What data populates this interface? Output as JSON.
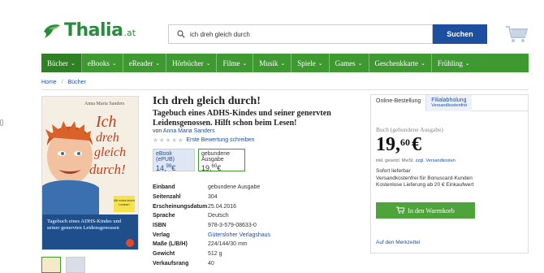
{
  "header": {
    "logo_text": "Thalia",
    "logo_tld": ".at",
    "search_value": "ich dreh gleich durch",
    "search_button": "Suchen",
    "brand_color": "#2a8a3e"
  },
  "nav": {
    "items": [
      {
        "label": "Bücher"
      },
      {
        "label": "eBooks"
      },
      {
        "label": "eReader"
      },
      {
        "label": "Hörbücher"
      },
      {
        "label": "Filme"
      },
      {
        "label": "Musik"
      },
      {
        "label": "Spiele"
      },
      {
        "label": "Games"
      },
      {
        "label": "Geschenkkarte"
      },
      {
        "label": "Frühling"
      }
    ],
    "chevron": "⌄"
  },
  "breadcrumb": {
    "home": "Home",
    "category": "Bücher",
    "sep": "/"
  },
  "cover": {
    "author": "Anna Maria Sanders",
    "title_line1": "Ich",
    "title_line2": "dreh",
    "title_line3": "gleich",
    "title_line4": "durch!",
    "sticker": "Mit extra leicht Lesbar!",
    "subtitle": "Tagebuch eines ADHS-Kindes und seiner genervten Leidensgenossen"
  },
  "product": {
    "title": "Ich dreh gleich durch!",
    "subtitle": "Tagebuch eines ADHS-Kindes und seiner genervten Leidensgenossen. Hilft schon beim Lesen!",
    "author_prefix": "von",
    "author": "Anna Maria Sanders",
    "stars": "★★★★★",
    "rating_link": "Erste Bewertung schreiben"
  },
  "formats": [
    {
      "label": "eBook (ePUB)",
      "price_main": "14,",
      "price_dec": "99",
      "price_cur": "€"
    },
    {
      "label": "gebundene Ausgabe",
      "price_main": "19,",
      "price_dec": "60",
      "price_cur": "€"
    }
  ],
  "specs": [
    {
      "key": "Einband",
      "value": "gebundene Ausgabe"
    },
    {
      "key": "Seitenzahl",
      "value": "304"
    },
    {
      "key": "Erscheinungsdatum",
      "value": "25.04.2016"
    },
    {
      "key": "Sprache",
      "value": "Deutsch"
    },
    {
      "key": "ISBN",
      "value": "978-3-579-08633-0"
    },
    {
      "key": "Verlag",
      "value": "Gütersloher Verlagshaus"
    },
    {
      "key": "Maße (L/B/H)",
      "value": "224/144/30 mm"
    },
    {
      "key": "Gewicht",
      "value": "512 g"
    },
    {
      "key": "Verkaufsrang",
      "value": "40"
    }
  ],
  "buybox": {
    "tab_online": "Online-Bestellung",
    "tab_pickup": "Filialabholung",
    "tab_pickup_small": "Versandkostenfrei",
    "format": "Buch (gebundene Ausgabe)",
    "price_main": "19,",
    "price_dec": "60",
    "price_cur": "€",
    "tax": "inkl. gesetzl. MwSt.",
    "shipping_link": "zzgl. Versandkosten",
    "info_line1": "Sofort lieferbar",
    "info_line2": "Versandkostenfrei für Bonuscard-Kunden",
    "info_line3": "Kostenlose Lieferung ab 20 € Einkaufwert",
    "cart_button": "In den Warenkorb",
    "wishlist_link": "Auf den Merkzettel",
    "cart_color": "#4ea33a"
  }
}
